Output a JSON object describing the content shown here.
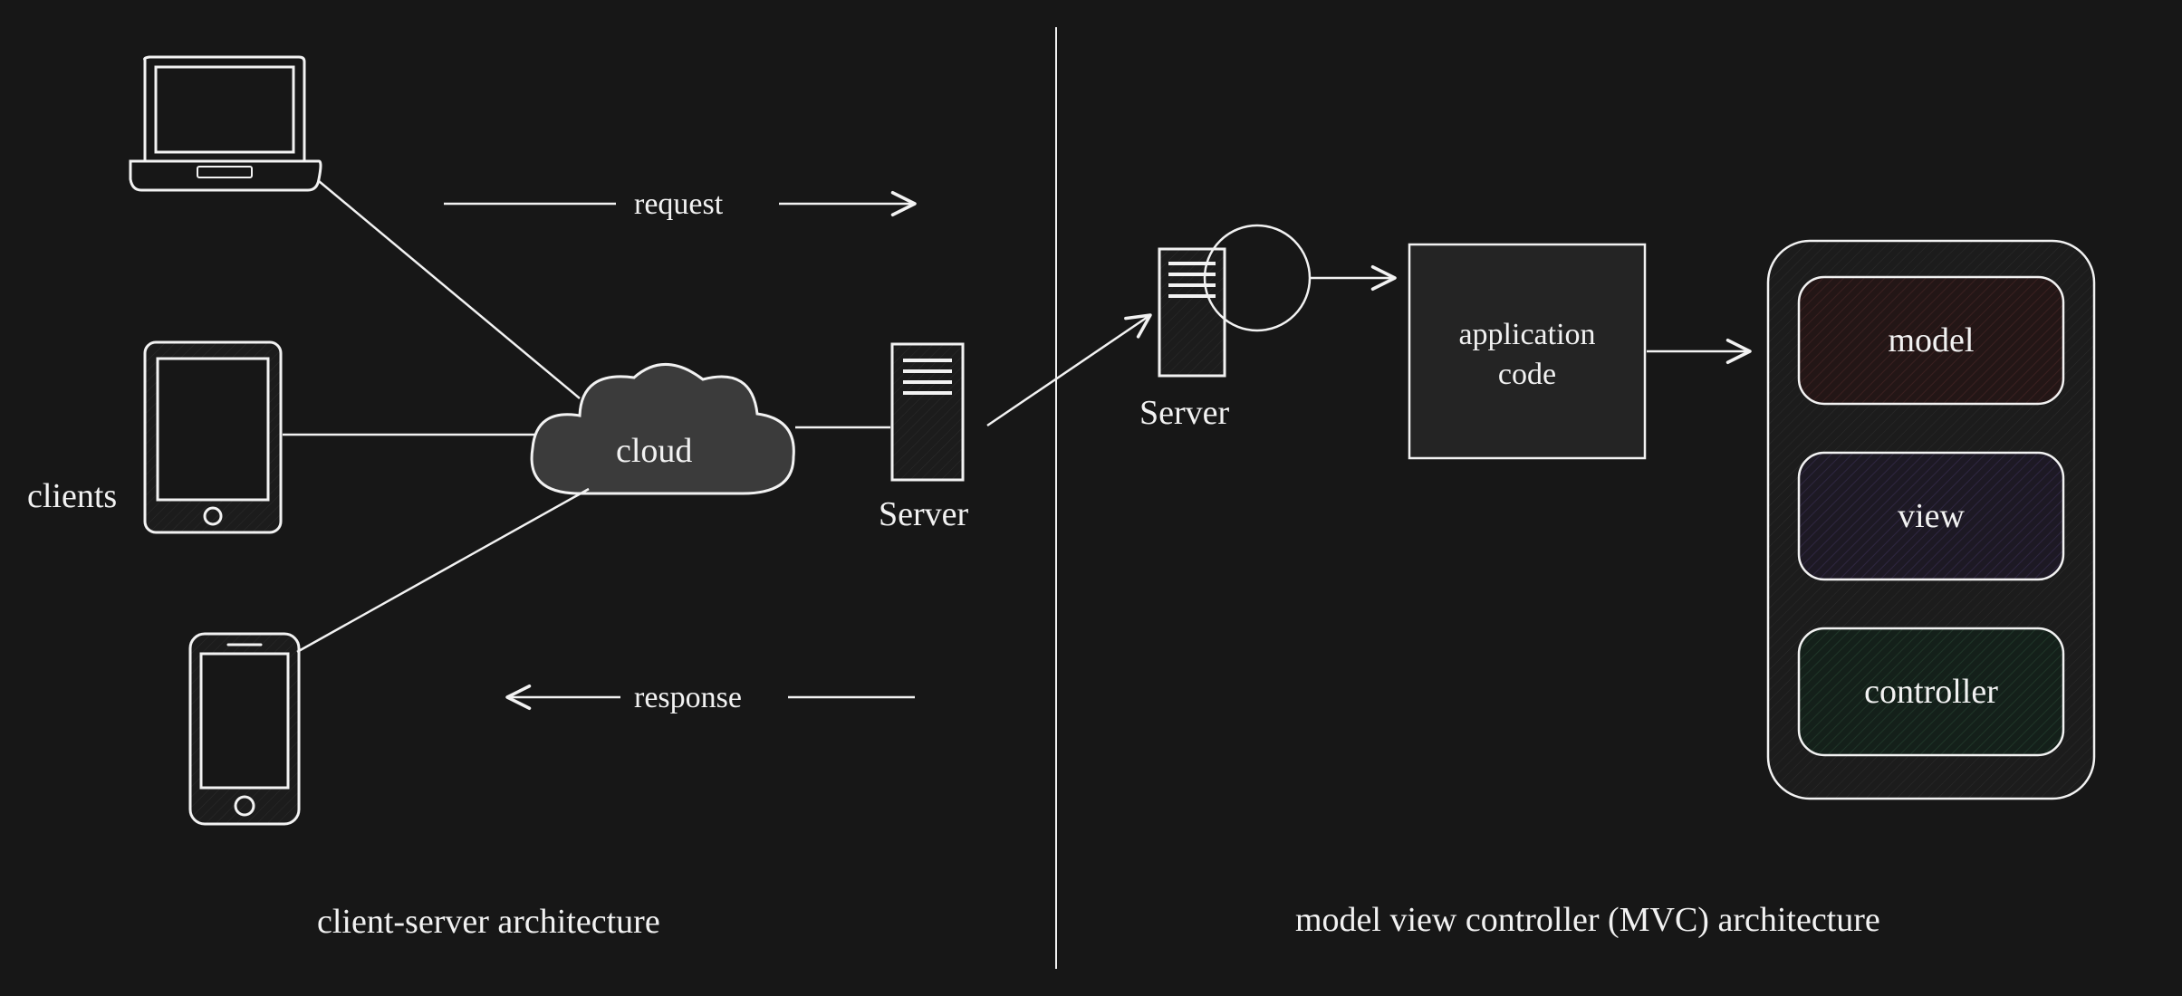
{
  "left": {
    "title": "client-server architecture",
    "clients_label": "clients",
    "cloud_label": "cloud",
    "server_label": "Server",
    "request_label": "request",
    "response_label": "response"
  },
  "right": {
    "title": "model view controller (MVC) architecture",
    "server_label": "Server",
    "appcode_line1": "application",
    "appcode_line2": "code",
    "model_label": "model",
    "view_label": "view",
    "controller_label": "controller"
  }
}
